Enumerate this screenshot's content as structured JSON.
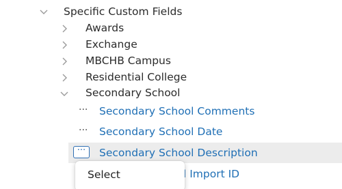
{
  "tree": {
    "root": {
      "label": "Specific Custom Fields",
      "icon": "chevron-down-icon"
    },
    "children": [
      {
        "label": "Awards",
        "icon": "chevron-right-icon"
      },
      {
        "label": "Exchange",
        "icon": "chevron-right-icon"
      },
      {
        "label": "MBCHB Campus",
        "icon": "chevron-right-icon"
      },
      {
        "label": "Residential College",
        "icon": "chevron-right-icon"
      },
      {
        "label": "Secondary School",
        "icon": "chevron-down-icon"
      }
    ],
    "fields": [
      {
        "label": "Secondary School Comments",
        "more": "···"
      },
      {
        "label": "Secondary School Date",
        "more": "···"
      },
      {
        "label": "Secondary School Description",
        "more": "···"
      },
      {
        "label": "l Import ID"
      }
    ]
  },
  "context_menu": {
    "items": [
      {
        "label": "Select"
      }
    ]
  },
  "colors": {
    "link": "#1f6fb5",
    "text": "#2b2b2b",
    "chevron": "#9a9a9a",
    "highlight": "#ececec",
    "focus": "#2f6fb3"
  }
}
